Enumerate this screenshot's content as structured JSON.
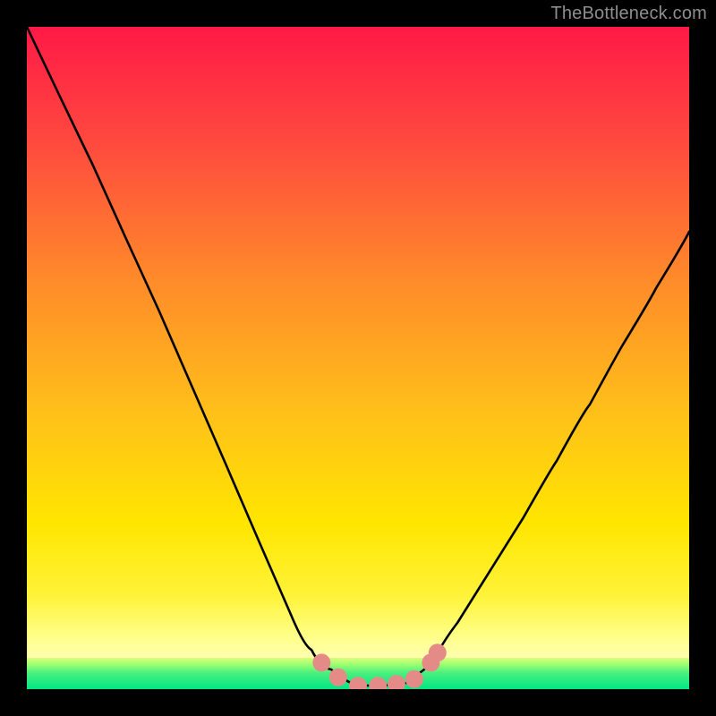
{
  "watermark": "TheBottleneck.com",
  "chart_data": {
    "type": "line",
    "title": "",
    "xlabel": "",
    "ylabel": "",
    "xlim": [
      0,
      1
    ],
    "ylim": [
      0,
      1
    ],
    "grid": false,
    "legend": false,
    "background_gradient": {
      "top": "#ff1946",
      "mid": "#ffd400",
      "bottom_band": "#ffff9a",
      "base": "#00e684"
    },
    "series": [
      {
        "name": "primary-curve",
        "color": "#000000",
        "x": [
          0.0,
          0.05,
          0.1,
          0.15,
          0.2,
          0.25,
          0.3,
          0.35,
          0.4,
          0.43,
          0.46,
          0.49,
          0.51,
          0.54,
          0.575,
          0.6,
          0.62,
          0.65,
          0.7,
          0.75,
          0.8,
          0.85,
          0.9,
          0.95,
          1.0
        ],
        "y": [
          1.0,
          0.895,
          0.79,
          0.68,
          0.57,
          0.455,
          0.34,
          0.225,
          0.11,
          0.06,
          0.03,
          0.01,
          0.005,
          0.005,
          0.01,
          0.03,
          0.055,
          0.1,
          0.18,
          0.26,
          0.345,
          0.43,
          0.52,
          0.605,
          0.69
        ]
      },
      {
        "name": "highlight-markers",
        "type": "scatter",
        "color": "#e58b87",
        "marker_radius": 10,
        "x": [
          0.445,
          0.47,
          0.5,
          0.53,
          0.558,
          0.585,
          0.61,
          0.62
        ],
        "y": [
          0.04,
          0.018,
          0.005,
          0.005,
          0.008,
          0.015,
          0.04,
          0.055
        ]
      }
    ]
  }
}
